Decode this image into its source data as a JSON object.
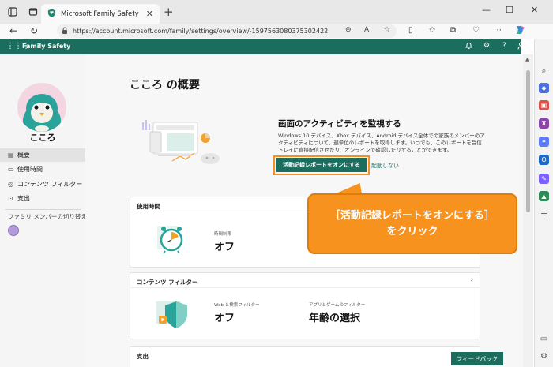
{
  "browser": {
    "tab_title": "Microsoft Family Safety",
    "tab_close": "✕",
    "new_tab": "+",
    "url": "https://account.microsoft.com/family/settings/overview/-1597563080375302422",
    "window_controls": [
      "—",
      "☐",
      "✕"
    ],
    "icons": [
      "sidebar-icon",
      "tab-actions-icon",
      "family-safety-favicon",
      "back-icon",
      "refresh-icon",
      "lock-icon",
      "zoom-icon",
      "read-aloud-icon",
      "favorite-icon",
      "split-screen-icon",
      "favorites-icon",
      "collections-icon",
      "browser-essentials-icon",
      "more-icon",
      "copilot-icon"
    ]
  },
  "app": {
    "name": "Family Safety",
    "header_icons": [
      "notification-icon",
      "settings-icon",
      "help-icon",
      "account-icon"
    ]
  },
  "profile": {
    "name": "こころ"
  },
  "nav": {
    "items": [
      {
        "label": "概要",
        "icon": "overview-icon"
      },
      {
        "label": "使用時間",
        "icon": "screen-time-icon"
      },
      {
        "label": "コンテンツ フィルター",
        "icon": "content-filter-icon"
      },
      {
        "label": "支出",
        "icon": "spending-icon"
      }
    ],
    "switch_label": "ファミリ メンバーの切り替え"
  },
  "main": {
    "title": "こころ の概要",
    "promo": {
      "title": "画面のアクティビティを監視する",
      "body": "Windows 10 デバイス、Xbox デバイス、Android デバイス全体での家族のメンバーのアクティビティについて、週単位のレポートを取得します。いつでも、このレポートを受信トレイに直接配信させたり、オンラインで確認したりすることができます。",
      "button": "活動記録レポートをオンにする",
      "link": "起動しない"
    },
    "screen_time": {
      "heading": "使用時間",
      "label": "時間制限",
      "value": "オフ"
    },
    "content_filter": {
      "heading": "コンテンツ フィルター",
      "chevron": "›",
      "web_label": "Web と検索フィルター",
      "web_value": "オフ",
      "apps_label": "アプリとゲームのフィルター",
      "apps_value": "年齢の選択"
    },
    "spending": {
      "heading": "支出"
    },
    "feedback": "フィードバック"
  },
  "callout": {
    "line1": "［活動記録レポートをオンにする］",
    "line2": "をクリック"
  },
  "colors": {
    "brand": "#1b6e5e",
    "callout": "#f7921e"
  }
}
